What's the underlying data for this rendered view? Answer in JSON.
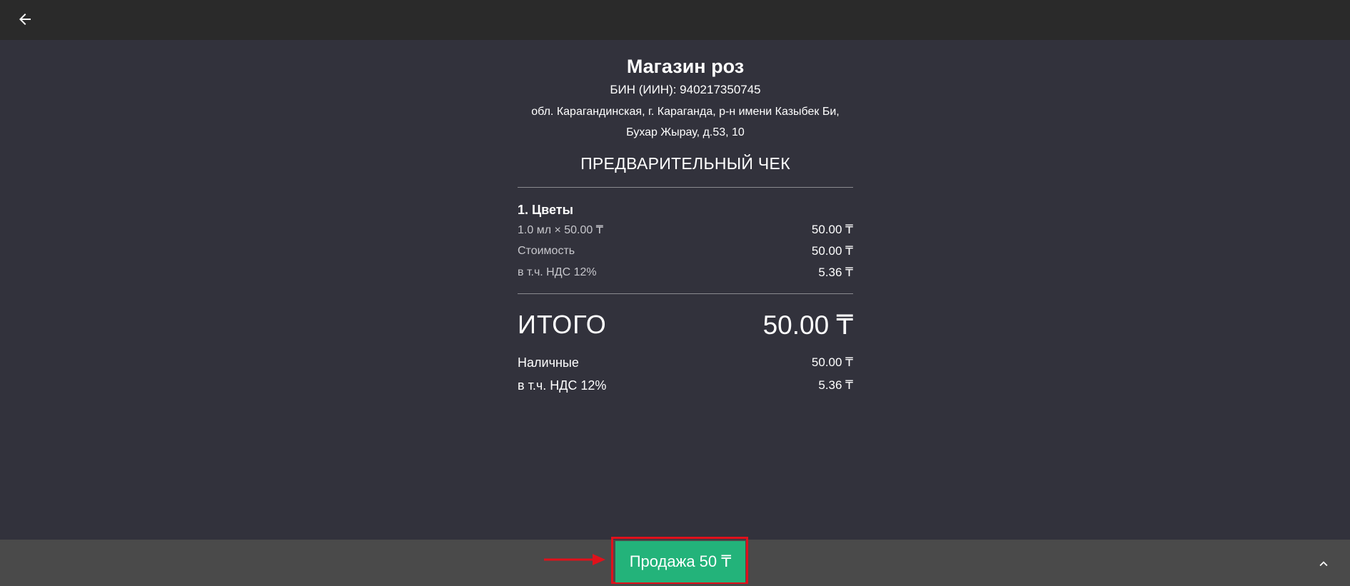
{
  "nav": {
    "back_icon": "arrow-left-icon"
  },
  "receipt": {
    "store_name": "Магазин роз",
    "bin": "БИН (ИИН): 940217350745",
    "address_line1": "обл. Карагандинская, г. Караганда, р-н имени Казыбек Би,",
    "address_line2": "Бухар Жырау, д.53, 10",
    "type": "ПРЕДВАРИТЕЛЬНЫЙ ЧЕК",
    "items": [
      {
        "title": "1. Цветы",
        "qty_label": "1.0 мл × 50.00 ₸",
        "qty_value": "50.00 ₸",
        "cost_label": "Стоимость",
        "cost_value": "50.00 ₸",
        "vat_label": "в т.ч. НДС 12%",
        "vat_value": "5.36 ₸"
      }
    ],
    "total_label": "ИТОГО",
    "total_value": "50.00 ₸",
    "payment_label": "Наличные",
    "payment_value": "50.00 ₸",
    "total_vat_label": "в т.ч. НДС 12%",
    "total_vat_value": "5.36 ₸"
  },
  "footer": {
    "sale_button_label": "Продажа 50 ₸",
    "expand_icon": "chevron-up-icon"
  },
  "colors": {
    "background": "#32323c",
    "topbar": "#2a2a2a",
    "bottombar": "#4a4a4a",
    "accent_green": "#23b37a",
    "annotation_red": "#e0111b"
  }
}
